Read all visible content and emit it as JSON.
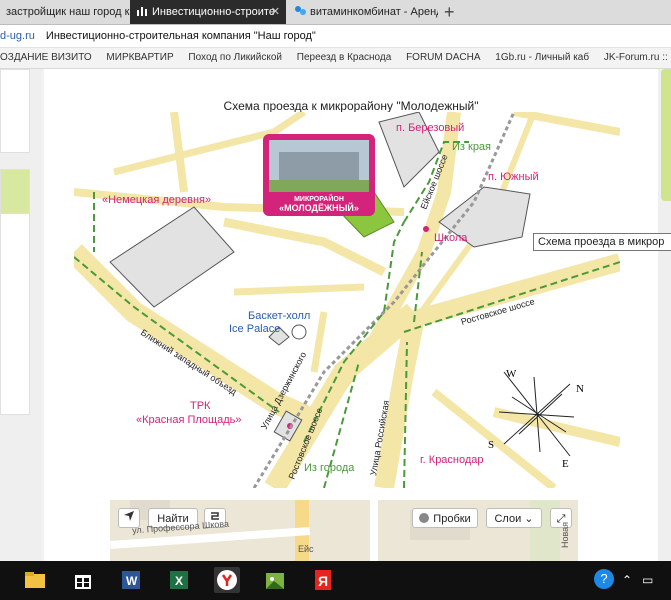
{
  "tabs": [
    {
      "label": "застройщик наш город кра"
    },
    {
      "label": "Инвестиционно-строите",
      "close": "✕"
    },
    {
      "label": "витаминкомбинат - Аренда"
    }
  ],
  "new_tab": "+",
  "address": {
    "url": "d-ug.ru",
    "title": "Инвестиционно-строительная компания \"Наш город\""
  },
  "bookmarks": [
    "ОЗДАНИЕ ВИЗИТО",
    "МИРКВАРТИР",
    "Поход по Ликийской",
    "Переезд в Краснода",
    "FORUM DACHA",
    "1Gb.ru - Личный каб",
    "JK-Forum.ru :: Фору"
  ],
  "page": {
    "caption": "Схема проезда к микрорайону \"Молодежный\"",
    "tooltip": "Схема проезда в микрор"
  },
  "map": {
    "labels": {
      "berezovy": "п. Березовый",
      "iz_kraya": "Из края",
      "yuzhny": "п. Южный",
      "nemetskaya": "«Немецкая деревня»",
      "shkola": "Школа",
      "basket1": "Баскет-холл",
      "basket2": "Ice Palace",
      "blizhny": "Ближний западный объезд",
      "rostov_right": "Ростовское шоссе",
      "dzerzhinsky": "Улица Дзержинского",
      "rostov_left": "Ростовское шоссе",
      "rossiyskaya": "Улица Российская",
      "eyskoe": "Ейское шоссе",
      "trk1": "ТРК",
      "trk2": "«Красная Площадь»",
      "iz_goroda": "Из города",
      "krasnodar": "г. Краснодар",
      "promo1": "МИКРОРАЙОН",
      "promo2": "«МОЛОДЁЖНЫЙ»",
      "compass_n": "N",
      "compass_e": "E",
      "compass_s": "S",
      "compass_w": "W"
    },
    "colors": {
      "road": "#f3e6a6",
      "block": "#e2e2e2",
      "route": "#4a9a3a",
      "pink": "#d3237a",
      "target": "#8cc63f"
    }
  },
  "yandex_map": {
    "find_label": "Найти",
    "traffic_label": "Пробки",
    "layers_label": "Слои",
    "street1": "ул. Профессора Шкова",
    "street2": "Ейс",
    "street3": "Новая"
  },
  "taskbar": {
    "lang_icon": "?",
    "icons": [
      "file-explorer-icon",
      "store-icon",
      "word-icon",
      "excel-icon",
      "yandex-browser-icon",
      "paint-icon",
      "yandex-icon"
    ]
  }
}
